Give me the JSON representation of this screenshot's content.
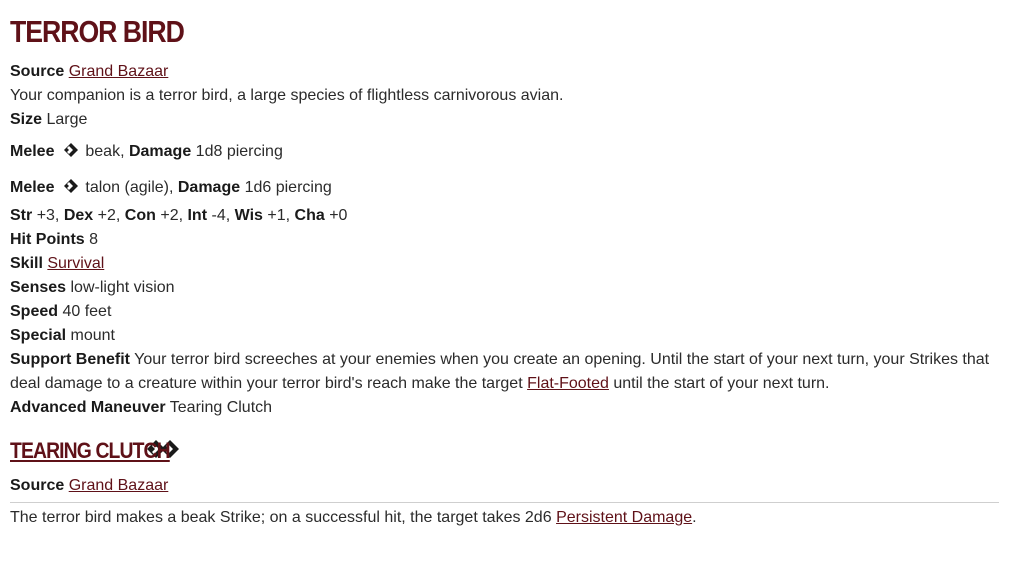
{
  "title": "TERROR BIRD",
  "source": {
    "label": "Source",
    "value": "Grand Bazaar"
  },
  "description": "Your companion is a terror bird, a large species of flightless carnivorous avian.",
  "size": {
    "label": "Size",
    "value": "Large"
  },
  "melee1": {
    "label": "Melee",
    "attack": "beak,",
    "damage_label": "Damage",
    "damage": "1d8 piercing"
  },
  "melee2": {
    "label": "Melee",
    "attack": "talon (agile),",
    "damage_label": "Damage",
    "damage": "1d6 piercing"
  },
  "stats": [
    {
      "label": "Str",
      "value": "+3,"
    },
    {
      "label": "Dex",
      "value": "+2,"
    },
    {
      "label": "Con",
      "value": "+2,"
    },
    {
      "label": "Int",
      "value": "-4,"
    },
    {
      "label": "Wis",
      "value": "+1,"
    },
    {
      "label": "Cha",
      "value": "+0"
    }
  ],
  "hp": {
    "label": "Hit Points",
    "value": "8"
  },
  "skill": {
    "label": "Skill",
    "value": "Survival"
  },
  "senses": {
    "label": "Senses",
    "value": "low-light vision"
  },
  "speed": {
    "label": "Speed",
    "value": "40 feet"
  },
  "special": {
    "label": "Special",
    "value": "mount"
  },
  "support": {
    "label": "Support Benefit",
    "text_before": "Your terror bird screeches at your enemies when you create an opening. Until the start of your next turn, your Strikes that deal damage to a creature within your terror bird's reach make the target",
    "link": "Flat-Footed",
    "text_after": "until the start of your next turn."
  },
  "advanced": {
    "label": "Advanced Maneuver",
    "value": "Tearing Clutch"
  },
  "maneuver": {
    "title": "TEARING CLUTCH",
    "source_label": "Source",
    "source_value": "Grand Bazaar",
    "text_before": "The terror bird makes a beak Strike; on a successful hit, the target takes 2d6",
    "link": "Persistent Damage",
    "text_after": "."
  },
  "colors": {
    "heading": "#5f1118",
    "text": "#2b2b2b"
  },
  "icons": {
    "single_action": "one-action-icon",
    "double_action": "two-action-icon"
  }
}
